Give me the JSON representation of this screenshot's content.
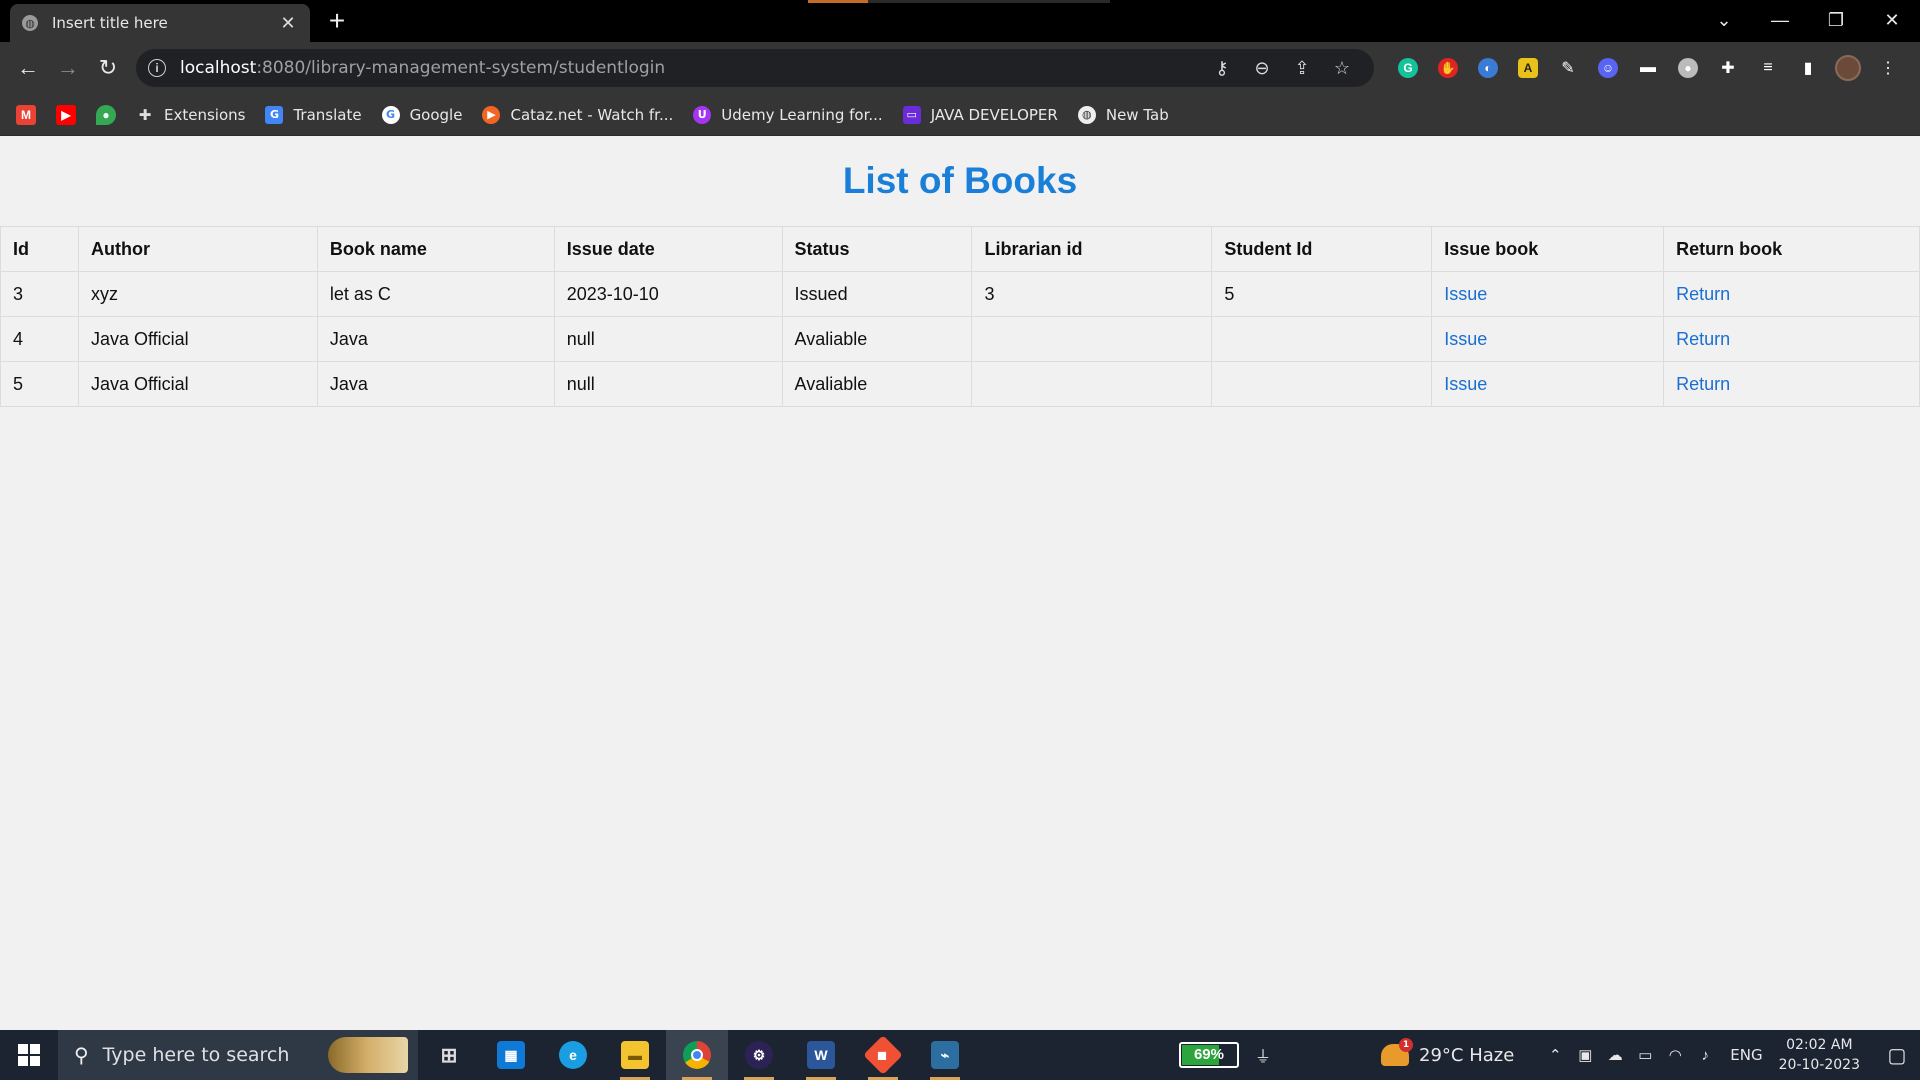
{
  "browser": {
    "tab_title": "Insert title here",
    "url_host": "localhost",
    "url_path": ":8080/library-management-system/studentlogin",
    "bookmarks": [
      "Extensions",
      "Translate",
      "Google",
      "Cataz.net - Watch fr...",
      "Udemy Learning for...",
      "JAVA DEVELOPER",
      "New Tab"
    ]
  },
  "page": {
    "heading": "List of Books",
    "columns": [
      "Id",
      "Author",
      "Book name",
      "Issue date",
      "Status",
      "Librarian id",
      "Student Id",
      "Issue book",
      "Return book"
    ],
    "rows": [
      {
        "id": "3",
        "author": "xyz",
        "book_name": "let as C",
        "issue_date": "2023-10-10",
        "status": "Issued",
        "librarian_id": "3",
        "student_id": "5",
        "issue": "Issue",
        "return": "Return"
      },
      {
        "id": "4",
        "author": "Java Official",
        "book_name": "Java",
        "issue_date": "null",
        "status": "Avaliable",
        "librarian_id": "",
        "student_id": "",
        "issue": "Issue",
        "return": "Return"
      },
      {
        "id": "5",
        "author": "Java Official",
        "book_name": "Java",
        "issue_date": "null",
        "status": "Avaliable",
        "librarian_id": "",
        "student_id": "",
        "issue": "Issue",
        "return": "Return"
      }
    ]
  },
  "taskbar": {
    "search_placeholder": "Type here to search",
    "battery_percent": "69%",
    "battery_level": 0.69,
    "weather": "29°C  Haze",
    "weather_badge": "1",
    "language": "ENG",
    "time": "02:02 AM",
    "date": "20-10-2023"
  },
  "colors": {
    "heading": "#1a7fd8",
    "link": "#1a6fd0",
    "battery": "#2ca53c"
  }
}
